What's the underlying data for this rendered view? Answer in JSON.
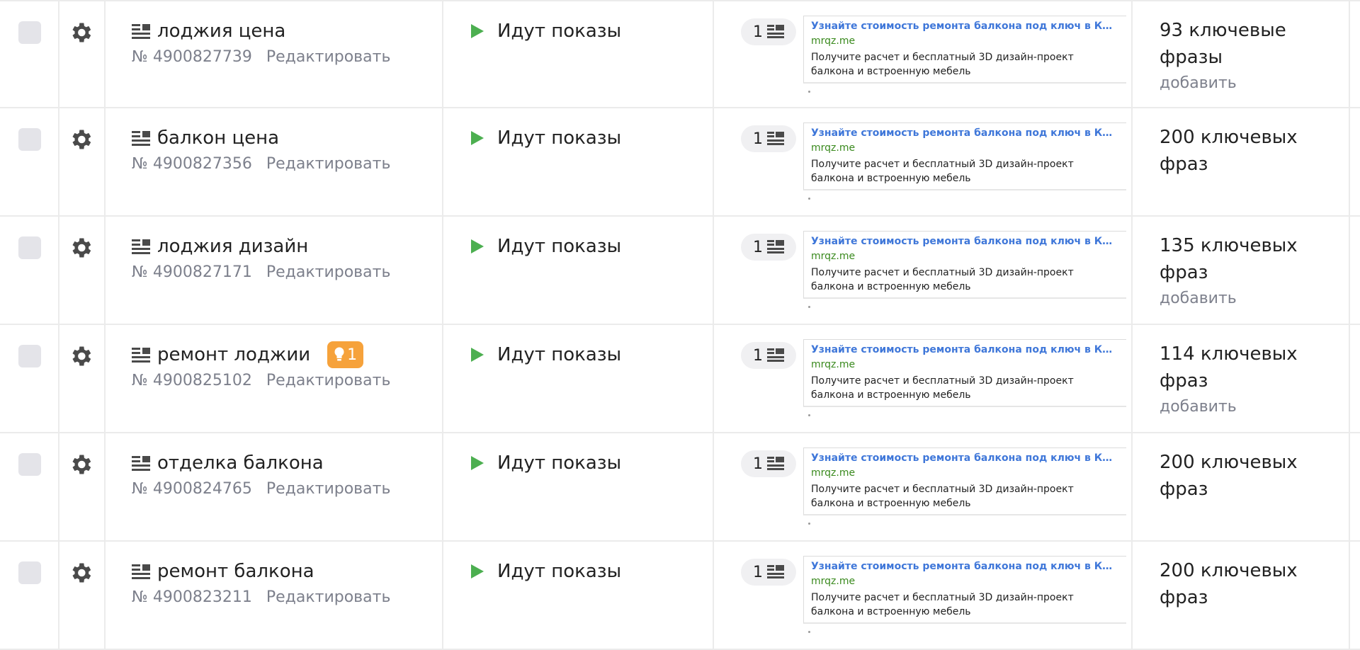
{
  "rows": [
    {
      "name": "лоджия цена",
      "number": "№ 4900827739",
      "edit": "Редактировать",
      "status": "Идут показы",
      "ads_count": "1",
      "ad_title": "Узнайте стоимость ремонта балкона под ключ в Краснода...",
      "ad_domain": "mrqz.me",
      "ad_text": "Получите расчет и бесплатный 3D дизайн-проект балкона и встроенную мебель",
      "phrases": "93 ключевые фразы",
      "add": "добавить",
      "badge": ""
    },
    {
      "name": "балкон цена",
      "number": "№ 4900827356",
      "edit": "Редактировать",
      "status": "Идут показы",
      "ads_count": "1",
      "ad_title": "Узнайте стоимость ремонта балкона под ключ в Краснода...",
      "ad_domain": "mrqz.me",
      "ad_text": "Получите расчет и бесплатный 3D дизайн-проект балкона и встроенную мебель",
      "phrases": "200 ключевых фраз",
      "add": "",
      "badge": ""
    },
    {
      "name": "лоджия дизайн",
      "number": "№ 4900827171",
      "edit": "Редактировать",
      "status": "Идут показы",
      "ads_count": "1",
      "ad_title": "Узнайте стоимость ремонта балкона под ключ в Краснода...",
      "ad_domain": "mrqz.me",
      "ad_text": "Получите расчет и бесплатный 3D дизайн-проект балкона и встроенную мебель",
      "phrases": "135 ключевых фраз",
      "add": "добавить",
      "badge": ""
    },
    {
      "name": "ремонт лоджии",
      "number": "№ 4900825102",
      "edit": "Редактировать",
      "status": "Идут показы",
      "ads_count": "1",
      "ad_title": "Узнайте стоимость ремонта балкона под ключ в Краснода...",
      "ad_domain": "mrqz.me",
      "ad_text": "Получите расчет и бесплатный 3D дизайн-проект балкона и встроенную мебель",
      "phrases": "114 ключевых фраз",
      "add": "добавить",
      "badge": "1"
    },
    {
      "name": "отделка балкона",
      "number": "№ 4900824765",
      "edit": "Редактировать",
      "status": "Идут показы",
      "ads_count": "1",
      "ad_title": "Узнайте стоимость ремонта балкона под ключ в Краснода...",
      "ad_domain": "mrqz.me",
      "ad_text": "Получите расчет и бесплатный 3D дизайн-проект балкона и встроенную мебель",
      "phrases": "200 ключевых фраз",
      "add": "",
      "badge": ""
    },
    {
      "name": "ремонт балкона",
      "number": "№ 4900823211",
      "edit": "Редактировать",
      "status": "Идут показы",
      "ads_count": "1",
      "ad_title": "Узнайте стоимость ремонта балкона под ключ в Краснода...",
      "ad_domain": "mrqz.me",
      "ad_text": "Получите расчет и бесплатный 3D дизайн-проект балкона и встроенную мебель",
      "phrases": "200 ключевых фраз",
      "add": "",
      "badge": ""
    }
  ],
  "colors": {
    "status_play": "#4caf50",
    "badge": "#f6a23b",
    "ad_title": "#3f77d9",
    "ad_domain": "#3a8a1e",
    "muted": "#7d808c"
  },
  "icons": {
    "row_select": "checkbox",
    "settings": "gear-icon",
    "group_type": "list-icon",
    "status": "play-icon",
    "recommendation": "lightbulb-icon",
    "ads": "ad-list-icon"
  }
}
